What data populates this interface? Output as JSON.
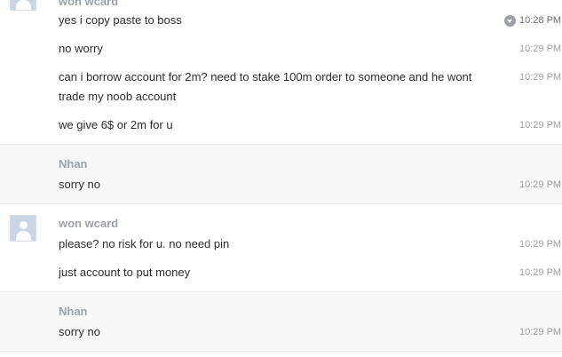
{
  "groups": [
    {
      "author": "won wcard",
      "has_avatar": true,
      "messages": [
        {
          "text": "yes i copy paste to boss",
          "time": "10:28 PM",
          "hovered": true
        },
        {
          "text": "no worry",
          "time": "10:29 PM"
        },
        {
          "text": "can i borrow account for 2m? need to stake 100m order to someone and he wont trade my noob account",
          "time": "10:29 PM"
        },
        {
          "text": "we give 6$ or 2m for u",
          "time": "10:29 PM"
        }
      ]
    },
    {
      "author": "Nhan",
      "has_avatar": false,
      "messages": [
        {
          "text": "sorry no",
          "time": "10:29 PM"
        }
      ]
    },
    {
      "author": "won wcard",
      "has_avatar": true,
      "messages": [
        {
          "text": "please? no risk for u. no need pin",
          "time": "10:29 PM"
        },
        {
          "text": "just account to put money",
          "time": "10:29 PM"
        }
      ]
    },
    {
      "author": "Nhan",
      "has_avatar": false,
      "messages": [
        {
          "text": "sorry no",
          "time": "10:29 PM"
        }
      ]
    }
  ],
  "icons": {
    "avatar": "default-user-avatar-icon",
    "message_actions": "chevron-down-circle-icon"
  },
  "colors": {
    "author": "#9aa3ab",
    "text": "#2c2d30",
    "timestamp": "#9aa0a6",
    "alt_background": "#f8f8f8",
    "divider": "#ececec"
  }
}
